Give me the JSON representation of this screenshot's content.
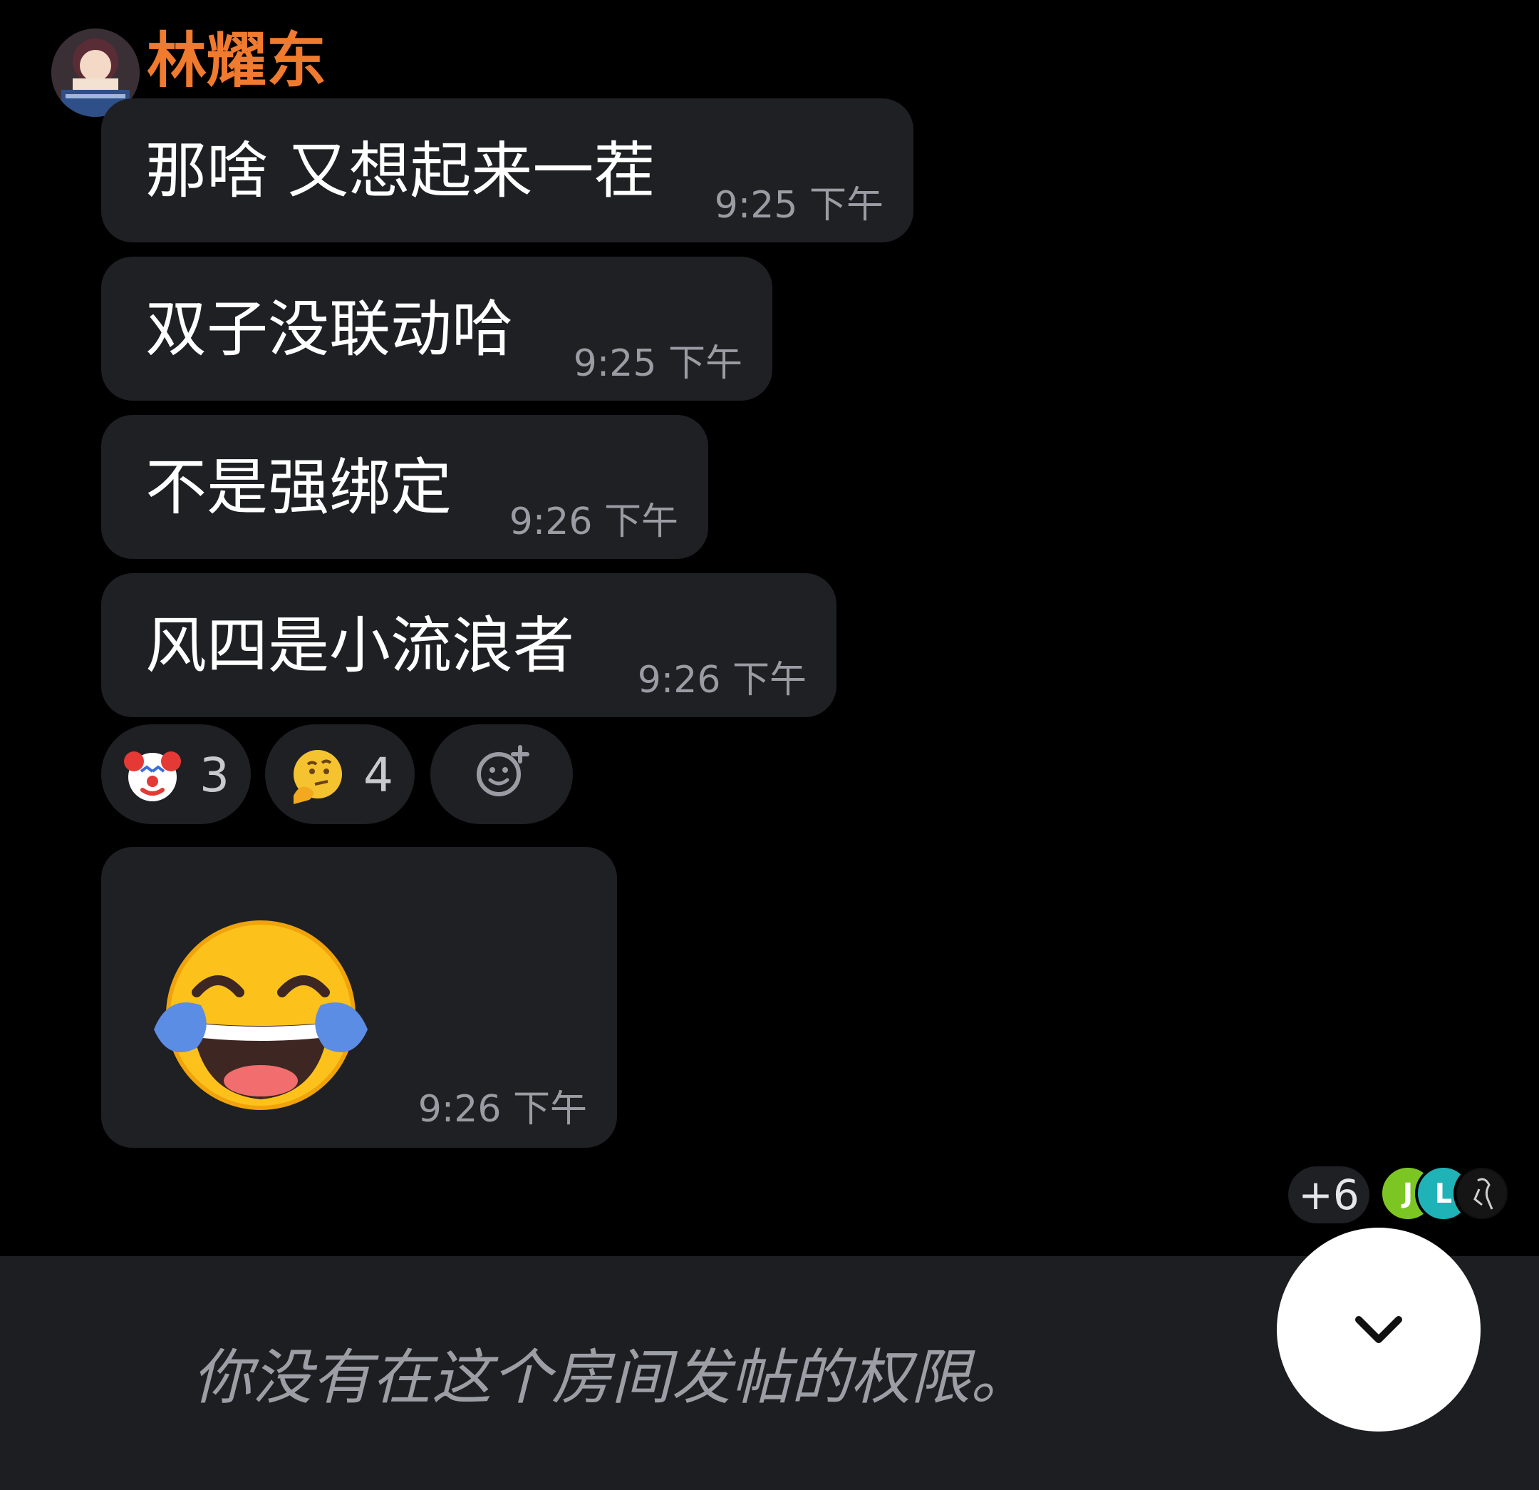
{
  "sender": {
    "name": "林耀东"
  },
  "messages": [
    {
      "text": "那啥 又想起来一茬",
      "time": "9:25 下午"
    },
    {
      "text": "双子没联动哈",
      "time": "9:25 下午"
    },
    {
      "text": "不是强绑定",
      "time": "9:26 下午"
    },
    {
      "text": "风四是小流浪者",
      "time": "9:26 下午"
    }
  ],
  "reactions": [
    {
      "emoji": "clown-face",
      "count": "3"
    },
    {
      "emoji": "thinking-face",
      "count": "4"
    }
  ],
  "emoji_message": {
    "emoji": "face-with-tears-of-joy",
    "time": "9:26 下午"
  },
  "readers": {
    "extra": "+6",
    "initials": [
      "J",
      "L"
    ]
  },
  "composer": {
    "notice": "你没有在这个房间发帖的权限。"
  }
}
